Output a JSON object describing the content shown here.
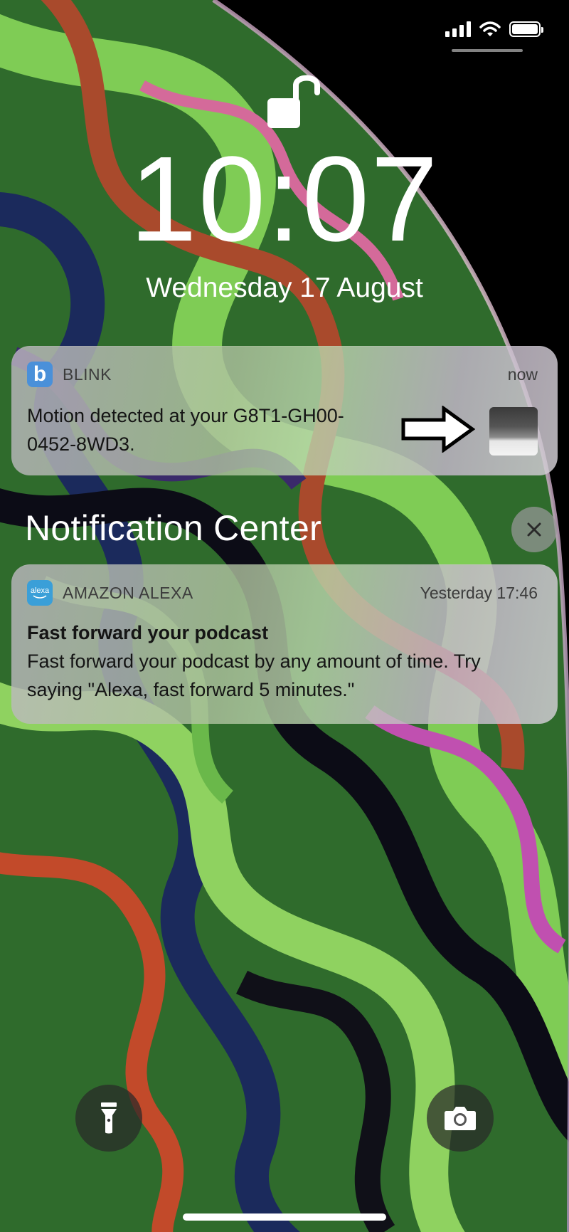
{
  "status_bar": {
    "signal_bars": 4,
    "battery_level": 1.0
  },
  "lock_screen": {
    "time": "10:07",
    "date": "Wednesday 17 August"
  },
  "notifications": [
    {
      "app": "BLINK",
      "app_icon": "blink-app-icon",
      "app_icon_letter": "b",
      "time": "now",
      "body": "Motion detected at your G8T1-GH00-0452-8WD3."
    }
  ],
  "notification_center": {
    "title": "Notification Center",
    "items": [
      {
        "app": "AMAZON ALEXA",
        "app_icon": "alexa-app-icon",
        "app_icon_text": "alexa",
        "time": "Yesterday 17:46",
        "title": "Fast forward your podcast",
        "body": "Fast forward your podcast by any amount of time. Try saying \"Alexa, fast forward 5 minutes.\""
      }
    ]
  },
  "colors": {
    "blink_icon": "#4a90d9",
    "alexa_icon": "#3a9fd8"
  },
  "icons": [
    "cellular-signal-icon",
    "wifi-icon",
    "battery-icon",
    "unlocked-padlock-icon",
    "pointing-arrow-icon",
    "close-icon",
    "flashlight-icon",
    "camera-icon"
  ]
}
